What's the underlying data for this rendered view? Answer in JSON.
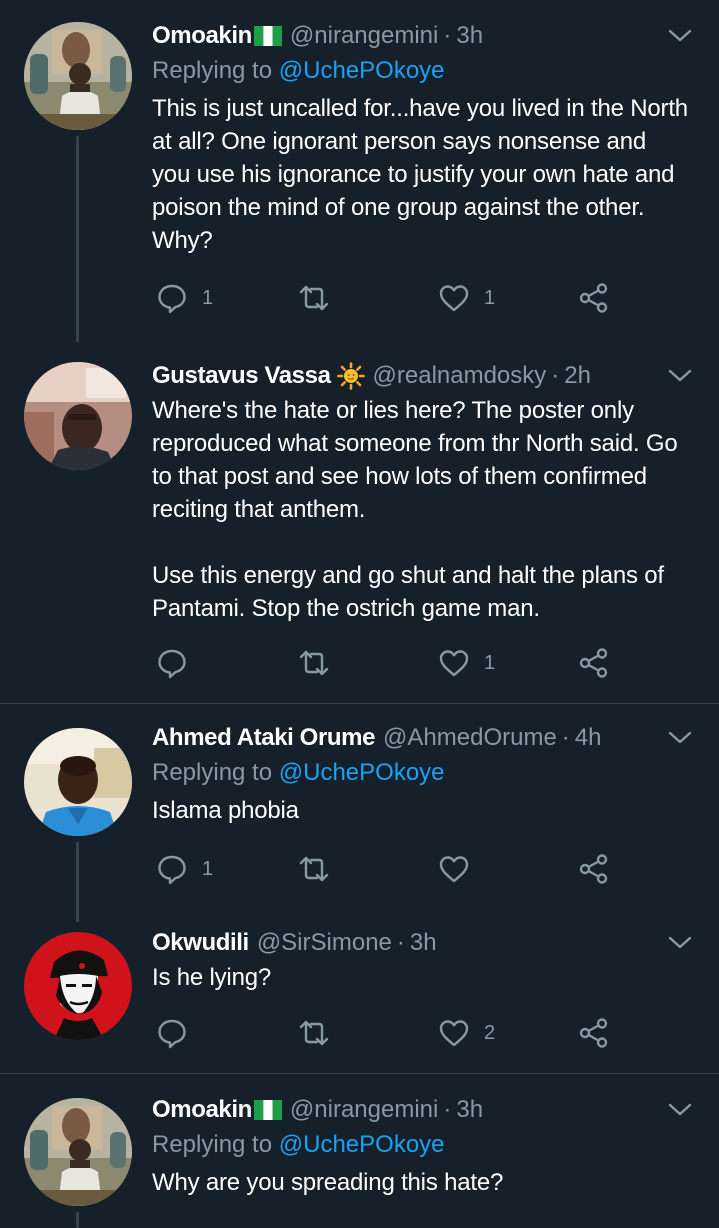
{
  "tweets": [
    {
      "name": "Omoakin",
      "has_flag": true,
      "handle": "@nirangemini",
      "separator": "·",
      "time": "3h",
      "replying_prefix": "Replying to ",
      "replying_to": "@UchePOkoye",
      "text": "This is just uncalled for...have you lived in the North at all? One ignorant person says nonsense and you use his ignorance to justify your own hate and poison the mind of one group against the other. Why?",
      "reply_count": "1",
      "retweet_count": "",
      "like_count": "1"
    },
    {
      "name": "Gustavus Vassa",
      "has_sun": true,
      "handle": "@realnamdosky",
      "separator": "·",
      "time": "2h",
      "text": "Where's the hate or lies here? The poster only reproduced what someone from thr North said. Go to that post and see how lots of them confirmed reciting that anthem.\n\nUse this energy and go shut and halt the plans of Pantami. Stop the ostrich game man.",
      "reply_count": "",
      "retweet_count": "",
      "like_count": "1"
    },
    {
      "name": "Ahmed Ataki Orume",
      "handle": "@AhmedOrume",
      "separator": "·",
      "time": "4h",
      "replying_prefix": "Replying to ",
      "replying_to": "@UchePOkoye",
      "text": "Islama phobia",
      "reply_count": "1",
      "retweet_count": "",
      "like_count": ""
    },
    {
      "name": "Okwudili",
      "handle": "@SirSimone",
      "separator": "·",
      "time": "3h",
      "text": "Is he lying?",
      "reply_count": "",
      "retweet_count": "",
      "like_count": "2"
    },
    {
      "name": "Omoakin",
      "has_flag": true,
      "handle": "@nirangemini",
      "separator": "·",
      "time": "3h",
      "replying_prefix": "Replying to ",
      "replying_to": "@UchePOkoye",
      "text": "Why are you spreading this hate?"
    }
  ],
  "colors": {
    "background": "#15202b",
    "secondary_text": "#8899a6",
    "link": "#1da1f2",
    "divider": "#38444d"
  },
  "icons": {
    "reply": "reply-bubble-icon",
    "retweet": "retweet-icon",
    "like": "heart-icon",
    "share": "share-icon",
    "more": "chevron-down-icon"
  }
}
